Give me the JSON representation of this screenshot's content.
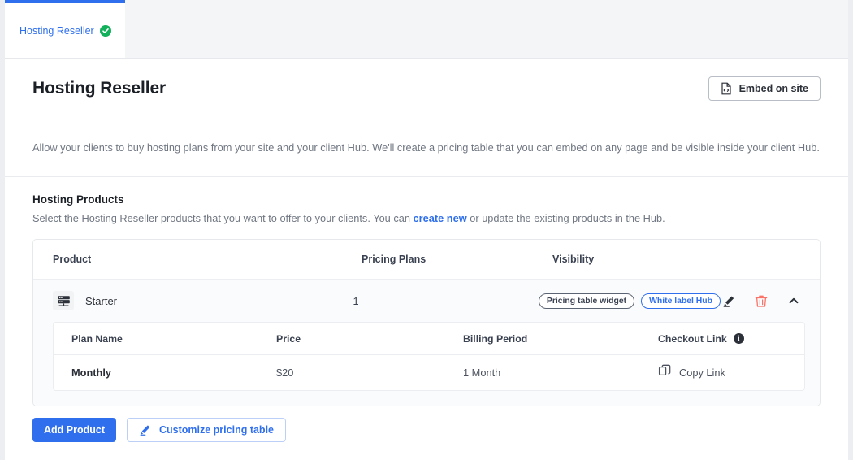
{
  "tab": {
    "label": "Hosting Reseller",
    "status_icon": "check-circle-icon",
    "status_color": "#12b05a",
    "active_border_color": "#2f6fed"
  },
  "header": {
    "title": "Hosting Reseller",
    "embed_button": {
      "label": "Embed on site",
      "icon": "embed-code-file-icon"
    }
  },
  "description": "Allow your clients to buy hosting plans from your site and your client Hub. We'll create a pricing table that you can embed on any page and be visible inside your client Hub.",
  "section": {
    "title": "Hosting Products",
    "subtitle_before": "Select the Hosting Reseller products that you want to offer to your clients. You can ",
    "link_label": "create new",
    "subtitle_after": " or update the existing products in the Hub."
  },
  "products_table": {
    "columns": [
      "Product",
      "Pricing Plans",
      "Visibility"
    ],
    "rows": [
      {
        "product_name": "Starter",
        "product_icon": "server-rack-icon",
        "pricing_plans": "1",
        "visibility_badges": [
          {
            "label": "Pricing table widget",
            "style": "grey"
          },
          {
            "label": "White label Hub",
            "style": "blue"
          }
        ],
        "actions": [
          {
            "icon": "pencil-edit-icon",
            "color": "#2c3038"
          },
          {
            "icon": "trash-delete-icon",
            "color": "#fa7268"
          },
          {
            "icon": "chevron-up-icon",
            "color": "#2c3038"
          }
        ],
        "plans_table": {
          "columns": [
            "Plan Name",
            "Price",
            "Billing Period",
            "Checkout Link"
          ],
          "checkout_info_icon": "info-circle-icon",
          "rows": [
            {
              "plan_name": "Monthly",
              "price": "$20",
              "billing_period": "1 Month",
              "checkout_link_label": "Copy Link",
              "checkout_link_icon": "copy-icon"
            }
          ]
        }
      }
    ]
  },
  "footer": {
    "add_product_label": "Add Product",
    "customize_label": "Customize pricing table",
    "customize_icon": "pencil-edit-icon"
  },
  "colors": {
    "accent": "#2f6fed",
    "success": "#12b05a",
    "danger": "#fa7268",
    "page_bg": "#f4f5f7",
    "card_bg": "#ffffff",
    "row_bg": "#fafbfc",
    "text_primary": "#1b1f26",
    "text_muted": "#707782"
  }
}
